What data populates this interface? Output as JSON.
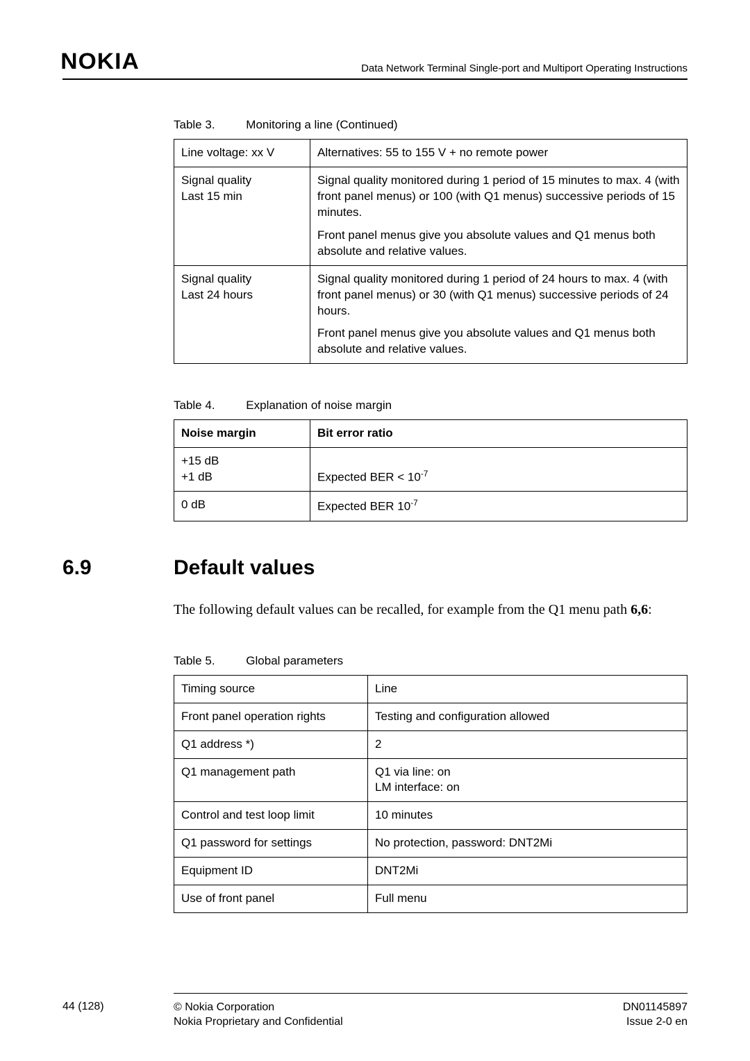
{
  "header": {
    "logo": "NOKIA",
    "doc_title": "Data Network Terminal Single-port and Multiport Operating Instructions"
  },
  "table3": {
    "caption_num": "Table 3.",
    "caption_title": "Monitoring a line (Continued)",
    "rows": [
      {
        "c1": "Line voltage: xx V",
        "c2": "Alternatives: 55 to 155 V + no remote power"
      },
      {
        "c1a": "Signal quality",
        "c1b": "Last 15 min",
        "c2a": "Signal quality monitored during 1 period of 15 minutes to max. 4 (with front panel menus) or 100 (with Q1 menus) successive periods of 15 minutes.",
        "c2b": "Front panel menus give you absolute values and Q1 menus both absolute and relative values."
      },
      {
        "c1a": "Signal quality",
        "c1b": "Last 24 hours",
        "c2a": "Signal quality monitored during 1 period of 24 hours to max. 4 (with front panel menus) or 30 (with Q1 menus) successive periods of 24 hours.",
        "c2b": "Front panel menus give you absolute values and Q1 menus both absolute and relative values."
      }
    ]
  },
  "table4": {
    "caption_num": "Table 4.",
    "caption_title": "Explanation of noise margin",
    "h1": "Noise margin",
    "h2": "Bit error ratio",
    "r1c1a": "+15 dB",
    "r1c1b": "+1 dB",
    "r1c2_prefix": "Expected BER < 10",
    "r1c2_sup": "-7",
    "r2c1": "0 dB",
    "r2c2_prefix": "Expected BER 10",
    "r2c2_sup": "-7"
  },
  "section": {
    "num": "6.9",
    "title": "Default values",
    "para_a": "The following default values can be recalled, for example from the Q1 menu path ",
    "para_b": "6,6",
    "para_c": ":"
  },
  "table5": {
    "caption_num": "Table 5.",
    "caption_title": "Global parameters",
    "rows": [
      {
        "c1": "Timing source",
        "c2": "Line"
      },
      {
        "c1": "Front panel operation rights",
        "c2": "Testing and configuration allowed"
      },
      {
        "c1": "Q1 address *)",
        "c2": "2"
      },
      {
        "c1": "Q1 management path",
        "c2a": "Q1 via line: on",
        "c2b": "LM interface: on"
      },
      {
        "c1": "Control and test loop limit",
        "c2": "10 minutes"
      },
      {
        "c1": "Q1 password for settings",
        "c2": "No protection, password: DNT2Mi"
      },
      {
        "c1": "Equipment ID",
        "c2": "DNT2Mi"
      },
      {
        "c1": "Use of front panel",
        "c2": "Full menu"
      }
    ]
  },
  "footer": {
    "page": "44 (128)",
    "mid1": "© Nokia Corporation",
    "mid2": "Nokia Proprietary and Confidential",
    "right1": "DN01145897",
    "right2": "Issue 2-0 en"
  }
}
